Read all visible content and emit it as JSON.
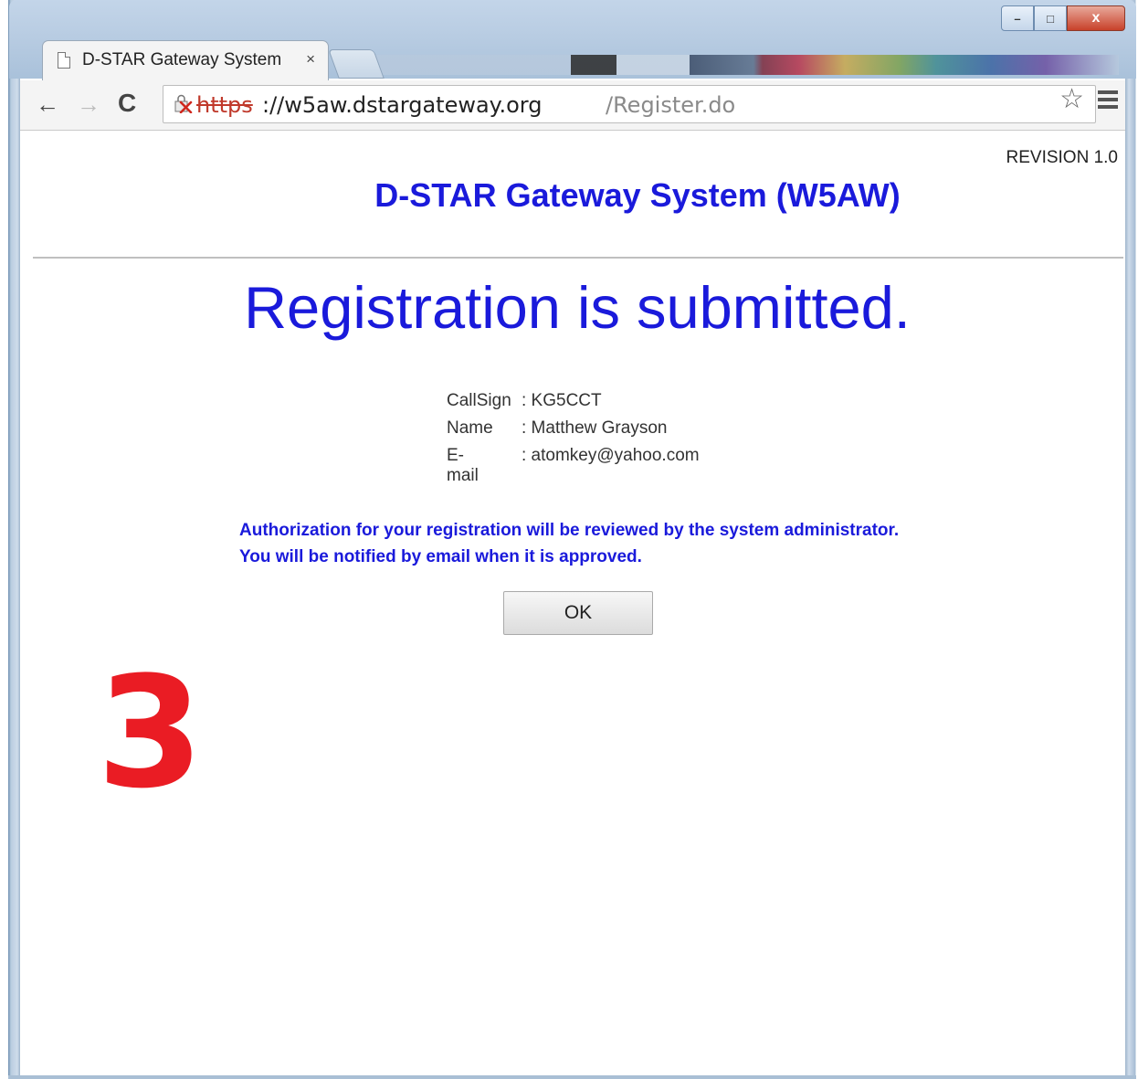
{
  "browser": {
    "tab": {
      "title": "D-STAR Gateway System",
      "close": "×"
    },
    "window_buttons": {
      "minimize": "–",
      "maximize": "□",
      "close": "x"
    },
    "toolbar": {
      "back": "←",
      "forward": "→",
      "reload": "C",
      "bookmark": "☆"
    },
    "url": {
      "scheme": "https",
      "host": "://w5aw.dstargateway.org",
      "path": "/Register.do"
    }
  },
  "page": {
    "revision": "REVISION 1.0",
    "site_title": "D-STAR Gateway System (W5AW)",
    "headline": "Registration is submitted.",
    "info": [
      {
        "label": "CallSign",
        "value": ": KG5CCT"
      },
      {
        "label": "Name",
        "value": ": Matthew Grayson"
      },
      {
        "label": "E-mail",
        "value": ": atomkey@yahoo.com"
      }
    ],
    "notice_line1": "Authorization for your registration will be reviewed by the system administrator.",
    "notice_line2": "You will be notified by email when it is approved.",
    "ok_label": "OK",
    "step_number": "3"
  },
  "colors": {
    "title_blue": "#1a1adb",
    "step_red": "#ea1c24"
  }
}
